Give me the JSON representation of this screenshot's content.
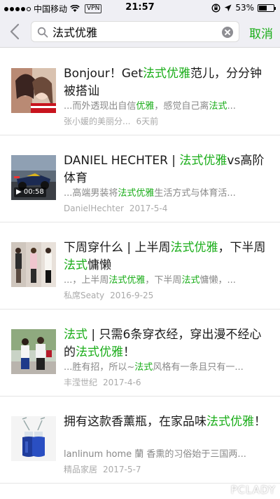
{
  "status": {
    "carrier": "中国移动",
    "vpn": "VPN",
    "time": "21:57",
    "battery": "53%",
    "battery_level": 0.53,
    "signal_filled": 4,
    "signal_total": 5
  },
  "search": {
    "query": "法式优雅",
    "cancel_label": "取消"
  },
  "results": [
    {
      "title": [
        {
          "t": "Bonjour！Get"
        },
        {
          "t": "法式优雅",
          "h": true
        },
        {
          "t": "范儿，分分钟被搭讪"
        }
      ],
      "excerpt": [
        {
          "t": "...而外透现出自信"
        },
        {
          "t": "优雅",
          "h": true
        },
        {
          "t": "，感觉自己离"
        },
        {
          "t": "法式",
          "h": true
        },
        {
          "t": "..."
        }
      ],
      "source": "张小媛的美丽分...",
      "date": "6天前",
      "thumb": "portrait"
    },
    {
      "title": [
        {
          "t": "DANIEL HECHTER | "
        },
        {
          "t": "法式优雅",
          "h": true
        },
        {
          "t": "vs高阶体育"
        }
      ],
      "excerpt": [
        {
          "t": "...高端男装将"
        },
        {
          "t": "法式优雅",
          "h": true
        },
        {
          "t": "生活方式与体育活..."
        }
      ],
      "source": "DanielHechter",
      "date": "2017-5-4",
      "thumb": "racing",
      "video_duration": "00:58"
    },
    {
      "title": [
        {
          "t": "下周穿什么 | 上半周"
        },
        {
          "t": "法式优雅",
          "h": true
        },
        {
          "t": "，下半周"
        },
        {
          "t": "法式",
          "h": true
        },
        {
          "t": "慵懒"
        }
      ],
      "excerpt": [
        {
          "t": "...，上半周"
        },
        {
          "t": "法式优雅",
          "h": true
        },
        {
          "t": "，下半周"
        },
        {
          "t": "法式",
          "h": true
        },
        {
          "t": "慵懒，..."
        }
      ],
      "source": "私席Seaty",
      "date": "2016-9-25",
      "thumb": "fashion-collage"
    },
    {
      "title": [
        {
          "t": "法式",
          "h": true
        },
        {
          "t": " | 只需6条穿衣经，穿出漫不经心的"
        },
        {
          "t": "法式优雅",
          "h": true
        },
        {
          "t": "！"
        }
      ],
      "excerpt": [
        {
          "t": "...胜有招，所以~"
        },
        {
          "t": "法式",
          "h": true
        },
        {
          "t": "风格有一条且只有一..."
        }
      ],
      "source": "丰滢世纪",
      "date": "2017-4-6",
      "thumb": "street-style"
    },
    {
      "title": [
        {
          "t": "拥有这款香薰瓶，在家品味"
        },
        {
          "t": "法式优雅",
          "h": true
        },
        {
          "t": "！"
        }
      ],
      "excerpt": [
        {
          "t": "lanlinum home 蘭 香熏的习俗始于三国两..."
        }
      ],
      "source": "精品家居",
      "date": "2017-5-7",
      "thumb": "bottles"
    }
  ],
  "watermark": "PCLADY",
  "colors": {
    "accent": "#1aad19",
    "navbar": "#efeff4"
  }
}
